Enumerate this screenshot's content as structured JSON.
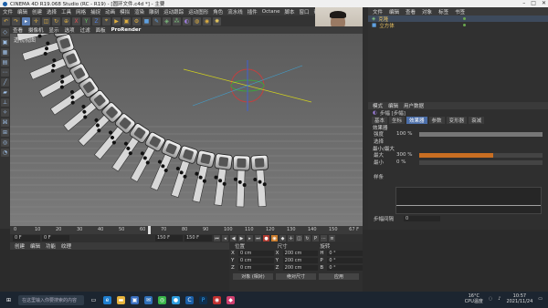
{
  "window": {
    "title": "CINEMA 4D R19.068 Studio (RC - R19) - [圆环文件.c4d *] - 主要"
  },
  "menubar": {
    "items": [
      "文件",
      "编辑",
      "创建",
      "选择",
      "工具",
      "网格",
      "捕捉",
      "动画",
      "模拟",
      "渲染",
      "雕刻",
      "运动跟踪",
      "运动图形",
      "角色",
      "流水线",
      "插件",
      "Octane",
      "脚本",
      "窗口",
      "帮助"
    ]
  },
  "viewport": {
    "menu": [
      "查看",
      "摄像机",
      "显示",
      "选项",
      "过滤",
      "面板",
      "ProRender"
    ],
    "label": "透视视图"
  },
  "object_manager": {
    "menu": [
      "文件",
      "编辑",
      "查看",
      "对象",
      "标签",
      "书签"
    ],
    "objects": [
      {
        "name": "克隆"
      },
      {
        "name": "立方体"
      }
    ]
  },
  "attribute_manager": {
    "menu": [
      "模式",
      "编辑",
      "用户数据"
    ],
    "title": "步幅 [步幅]",
    "tabs": [
      "基本",
      "坐标",
      "效果器",
      "参数",
      "变形器",
      "衰减"
    ],
    "active_tab": "效果器",
    "section": "效果器",
    "strength_label": "强度",
    "strength_value": "100 %",
    "strength_fraction": 1.0,
    "selection_label": "选择",
    "minmax_label": "最小/最大",
    "max_label": "最大",
    "max_value": "300 %",
    "max_fraction": 0.6,
    "min_label": "最小",
    "min_value": "0 %",
    "min_fraction": 0.0,
    "spline_label": "样条",
    "step_gap_label": "步幅间隔",
    "step_gap_value": "0"
  },
  "timeline": {
    "ticks": [
      "0",
      "10",
      "20",
      "30",
      "40",
      "50",
      "60",
      "70",
      "80",
      "90",
      "100",
      "110",
      "120",
      "130",
      "140",
      "150"
    ],
    "end_label": "67 F"
  },
  "playbar": {
    "start": "0 F",
    "current": "0 F",
    "end": "150 F",
    "end2": "150 F"
  },
  "material_manager": {
    "menu": [
      "创建",
      "编辑",
      "功能",
      "纹理"
    ]
  },
  "coordinates": {
    "headers": [
      "位置",
      "尺寸",
      "旋转"
    ],
    "rows": [
      {
        "axis": "X",
        "pos": "0 cm",
        "size": "200 cm",
        "rot_axis": "H",
        "rot": "0 °"
      },
      {
        "axis": "Y",
        "pos": "0 cm",
        "size": "200 cm",
        "rot_axis": "P",
        "rot": "0 °"
      },
      {
        "axis": "Z",
        "pos": "0 cm",
        "size": "200 cm",
        "rot_axis": "B",
        "rot": "0 °"
      }
    ],
    "mode_button": "对象 (相对)",
    "size_button": "绝对尺寸",
    "apply_button": "应用"
  },
  "taskbar": {
    "search_placeholder": "在这里输入你要搜索的内容",
    "time": "10:57",
    "date": "2021/11/24",
    "weather": "16°C",
    "weather_desc": "CPU温度"
  }
}
